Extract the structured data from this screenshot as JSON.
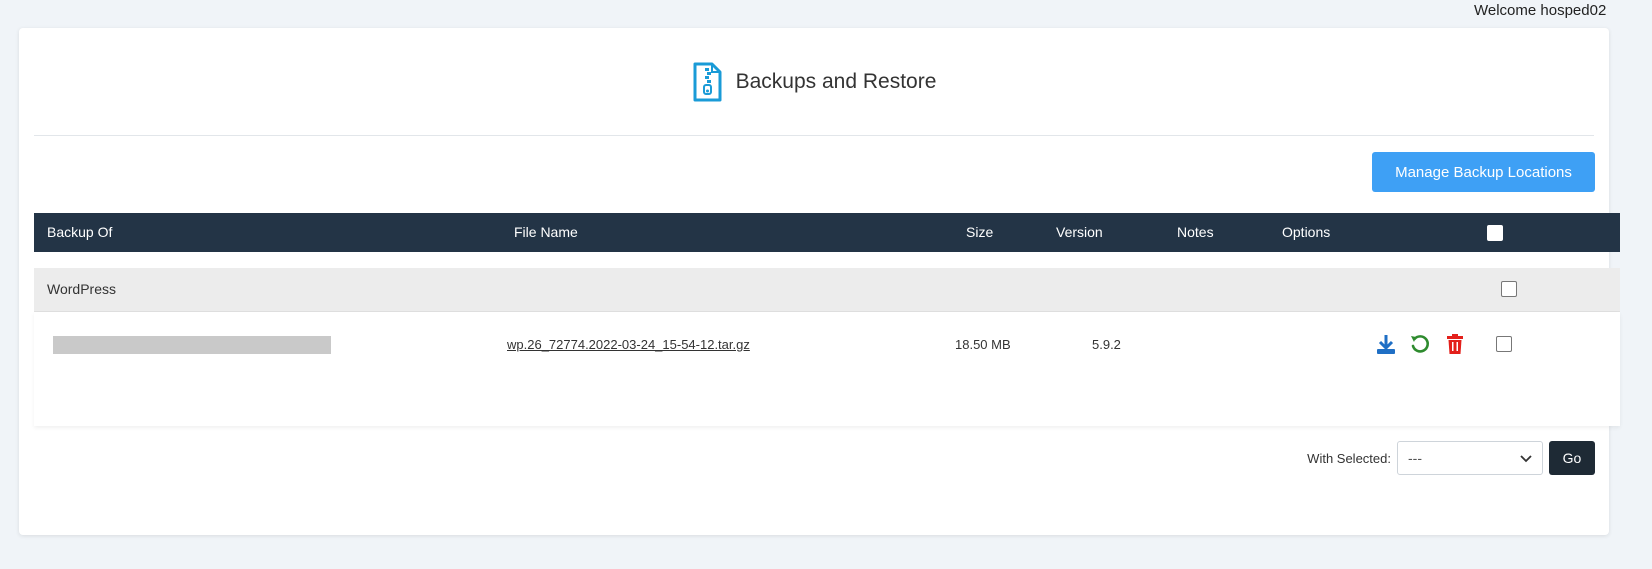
{
  "welcome_text": "Welcome hosped02",
  "page_title": "Backups and Restore",
  "manage_button": "Manage Backup Locations",
  "table": {
    "headers": {
      "backup_of": "Backup Of",
      "file_name": "File Name",
      "size": "Size",
      "version": "Version",
      "notes": "Notes",
      "options": "Options"
    },
    "groups": [
      {
        "name": "WordPress",
        "rows": [
          {
            "backup_of": "",
            "file_name": "wp.26_72774.2022-03-24_15-54-12.tar.gz",
            "size": "18.50 MB",
            "version": "5.9.2",
            "notes": ""
          }
        ]
      }
    ]
  },
  "footer": {
    "with_selected_label": "With Selected:",
    "select_value": "---",
    "go_button": "Go"
  },
  "colors": {
    "table_header_bg": "#233446",
    "manage_button_bg": "#3ea0f5",
    "download_icon": "#1f6fc5",
    "restore_icon": "#2e8b2e",
    "delete_icon": "#e3201b",
    "title_icon": "#1a9bd7"
  },
  "icons": {
    "title": "zip-file-icon",
    "download": "download-icon",
    "restore": "restore-icon",
    "delete": "trash-icon"
  }
}
